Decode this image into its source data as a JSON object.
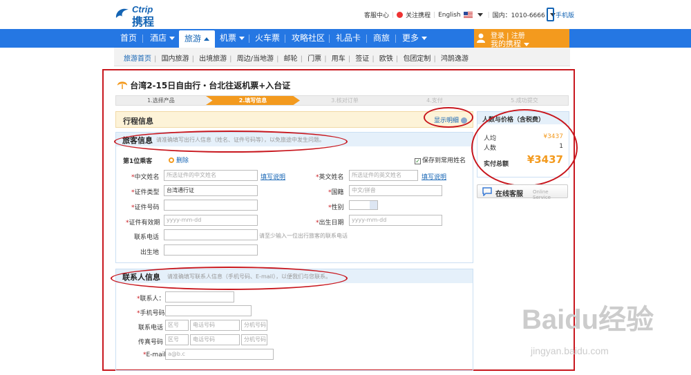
{
  "header": {
    "logo_en": "Ctrip",
    "logo_cn": "携程",
    "links": [
      "客服中心",
      "关注携程",
      "English",
      "国内：1010-6666"
    ],
    "mobile": "手机版"
  },
  "nav": {
    "items": [
      "首页",
      "酒店",
      "旅游",
      "机票",
      "火车票",
      "攻略社区",
      "礼品卡",
      "商旅",
      "更多"
    ],
    "login_line1": "登录 | 注册",
    "login_line2": "我的携程"
  },
  "subnav": [
    "旅游首页",
    "国内旅游",
    "出境旅游",
    "周边/当地游",
    "邮轮",
    "门票",
    "用车",
    "签证",
    "欧铁",
    "包团定制",
    "鸿鹄逸游"
  ],
  "page": {
    "title": "台湾2-15日自由行・台北往返机票+入台证",
    "steps": [
      "1.选择产品",
      "2.填写信息",
      "3.核对订单",
      "4.支付",
      "5.成功提交"
    ]
  },
  "itinerary": {
    "title": "行程信息",
    "toggle": "显示明细"
  },
  "traveler": {
    "title": "旅客信息",
    "hint": "请准确填写出行人信息（姓名、证件号码等），以免旅途中发生问题。",
    "passenger": "第1位乘客",
    "delete": "删除",
    "save": "保存到常用姓名",
    "cn_name": {
      "label": "中文姓名",
      "placeholder": "所选证件的中文姓名",
      "link": "填写说明"
    },
    "en_name": {
      "label": "英文姓名",
      "placeholder": "所选证件的英文姓名",
      "link": "填写说明"
    },
    "id_type": {
      "label": "证件类型",
      "value": "台湾通行证"
    },
    "nationality": {
      "label": "国籍",
      "placeholder": "中文/拼音"
    },
    "id_no": {
      "label": "证件号码"
    },
    "gender": {
      "label": "性别"
    },
    "expiry": {
      "label": "证件有效期",
      "placeholder": "yyyy-mm-dd"
    },
    "birth": {
      "label": "出生日期",
      "placeholder": "yyyy-mm-dd"
    },
    "phone": {
      "label": "联系电话",
      "note": "请至少输入一位出行旅客的联系电话"
    },
    "birthplace": {
      "label": "出生地"
    }
  },
  "contact": {
    "title": "联系人信息",
    "hint": "请准确填写联系人信息（手机号码、E-mail），以便我们与您联系。",
    "name": "联系人：",
    "mobile": "手机号码",
    "tel": "联系电话",
    "fax": "传真号码",
    "email": "E-mail",
    "area_ph": "区号",
    "num_ph": "电话号码",
    "ext_ph": "分机号码",
    "email_ph": "a@b.c"
  },
  "price": {
    "title": "人数与价格（含税费）",
    "per_label": "人均",
    "per_value": "¥3437",
    "count_label": "人数",
    "count_value": "1",
    "total_label": "实付总额",
    "total_value": "¥3437"
  },
  "service": {
    "label": "在线客服",
    "en": "Online Service"
  },
  "watermark": {
    "brand": "Baidu经验",
    "url": "jingyan.baidu.com"
  },
  "colors": {
    "nav_blue": "#2577e3",
    "orange": "#f39a1e",
    "annotation_red": "#c8161d"
  }
}
